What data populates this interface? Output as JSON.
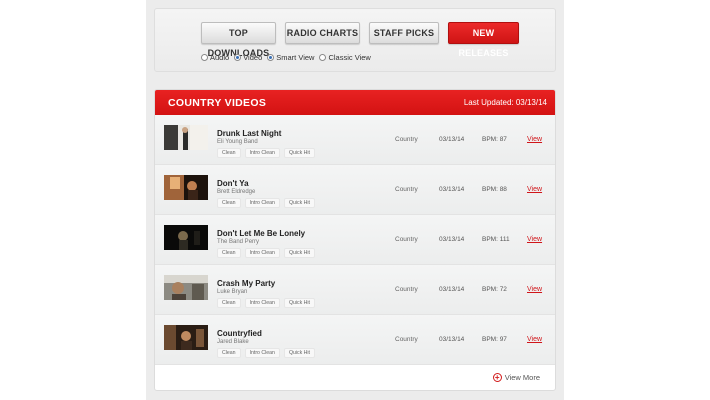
{
  "tabs": [
    {
      "label": "Top Downloads"
    },
    {
      "label": "Radio Charts"
    },
    {
      "label": "Staff Picks"
    },
    {
      "label": "New Releases",
      "active": true
    }
  ],
  "view_options": [
    {
      "label": "Audio",
      "checked": false
    },
    {
      "label": "Video",
      "checked": true
    },
    {
      "label": "Smart View",
      "checked": true
    },
    {
      "label": "Classic View",
      "checked": false
    }
  ],
  "list": {
    "title": "COUNTRY VIDEOS",
    "updated": "Last Updated: 03/13/14",
    "view_more": "View More",
    "items": [
      {
        "title": "Drunk Last Night",
        "artist": "Eli Young Band",
        "genre": "Country",
        "date": "03/13/14",
        "bpm": "BPM: 87",
        "view": "View",
        "edits": [
          "Clean",
          "Intro Clean",
          "Quick Hit"
        ]
      },
      {
        "title": "Don't Ya",
        "artist": "Brett Eldredge",
        "genre": "Country",
        "date": "03/13/14",
        "bpm": "BPM: 88",
        "view": "View",
        "edits": [
          "Clean",
          "Intro Clean",
          "Quick Hit"
        ]
      },
      {
        "title": "Don't Let Me Be Lonely",
        "artist": "The Band Perry",
        "genre": "Country",
        "date": "03/13/14",
        "bpm": "BPM: 111",
        "view": "View",
        "edits": [
          "Clean",
          "Intro Clean",
          "Quick Hit"
        ]
      },
      {
        "title": "Crash My Party",
        "artist": "Luke Bryan",
        "genre": "Country",
        "date": "03/13/14",
        "bpm": "BPM: 72",
        "view": "View",
        "edits": [
          "Clean",
          "Intro Clean",
          "Quick Hit"
        ]
      },
      {
        "title": "Countryfied",
        "artist": "Jared Blake",
        "genre": "Country",
        "date": "03/13/14",
        "bpm": "BPM: 97",
        "view": "View",
        "edits": [
          "Clean",
          "Intro Clean",
          "Quick Hit"
        ]
      }
    ]
  },
  "icons": {
    "view_more": "plus-circle-icon"
  },
  "colors": {
    "accent": "#d31212",
    "link": "#d0161b"
  }
}
